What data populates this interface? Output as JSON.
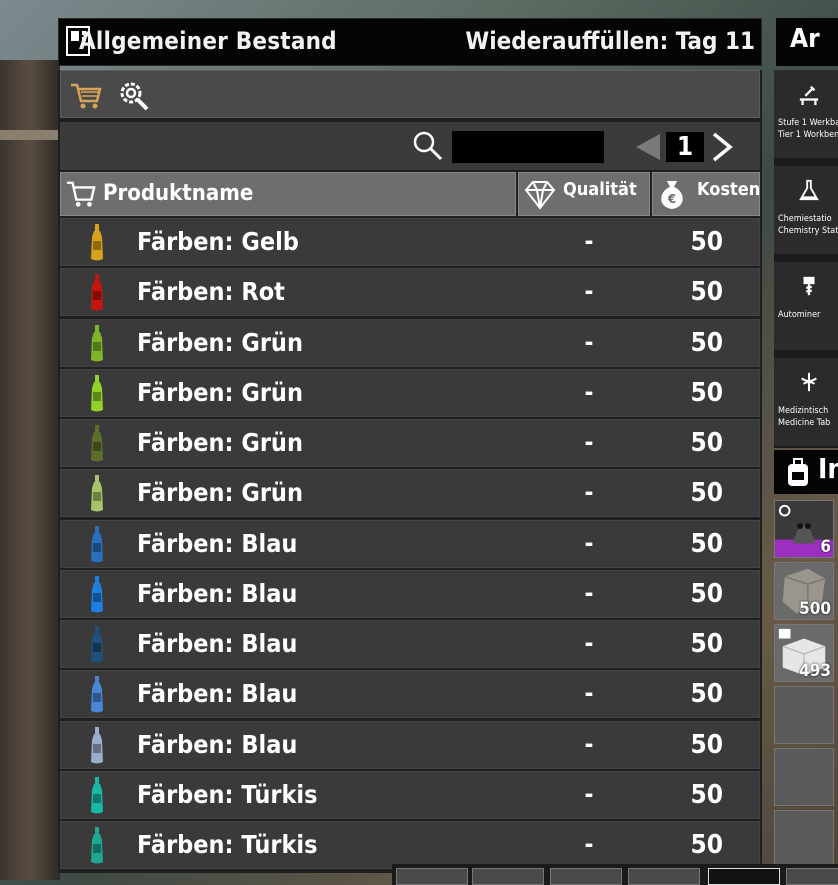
{
  "window": {
    "title": "Allgemeiner Bestand",
    "restock": "Wiederauffüllen: Tag 11"
  },
  "search": {
    "value": "",
    "placeholder": ""
  },
  "pager": {
    "page": "1"
  },
  "columns": {
    "name": "Produktname",
    "quality": "Qualität",
    "cost": "Kosten"
  },
  "items": [
    {
      "name": "Färben: Gelb",
      "quality": "-",
      "cost": "50",
      "color": "#d9a21c"
    },
    {
      "name": "Färben: Rot",
      "quality": "-",
      "cost": "50",
      "color": "#c3160f"
    },
    {
      "name": "Färben: Grün",
      "quality": "-",
      "cost": "50",
      "color": "#7fb52a"
    },
    {
      "name": "Färben: Grün",
      "quality": "-",
      "cost": "50",
      "color": "#8fd22a"
    },
    {
      "name": "Färben: Grün",
      "quality": "-",
      "cost": "50",
      "color": "#5c6e2c"
    },
    {
      "name": "Färben: Grün",
      "quality": "-",
      "cost": "50",
      "color": "#a8c46a"
    },
    {
      "name": "Färben: Blau",
      "quality": "-",
      "cost": "50",
      "color": "#2a6fbd"
    },
    {
      "name": "Färben: Blau",
      "quality": "-",
      "cost": "50",
      "color": "#1d7fe0"
    },
    {
      "name": "Färben: Blau",
      "quality": "-",
      "cost": "50",
      "color": "#1f4f7a"
    },
    {
      "name": "Färben: Blau",
      "quality": "-",
      "cost": "50",
      "color": "#4a86d6"
    },
    {
      "name": "Färben: Blau",
      "quality": "-",
      "cost": "50",
      "color": "#9aaecb"
    },
    {
      "name": "Färben: Türkis",
      "quality": "-",
      "cost": "50",
      "color": "#18b8a6"
    },
    {
      "name": "Färben: Türkis",
      "quality": "-",
      "cost": "50",
      "color": "#1ea892"
    }
  ],
  "side": {
    "title": "Ar",
    "stations": [
      {
        "l1": "Stufe 1 Werkba",
        "l2": "Tier 1 Workben",
        "icon": "workbench-icon"
      },
      {
        "l1": "Chemiestatio",
        "l2": "Chemistry Stati",
        "icon": "flask-icon"
      },
      {
        "l1": "Autominer",
        "l2": "",
        "icon": "drill-icon"
      },
      {
        "l1": "Medizintisch",
        "l2": "Medicine Tab",
        "icon": "medicine-icon"
      }
    ],
    "inventory_title": "In",
    "slots": [
      {
        "count": "6",
        "icon": "mask-icon"
      },
      {
        "count": "500",
        "icon": "stone-icon"
      },
      {
        "count": "493",
        "icon": "concrete-icon"
      },
      {
        "count": "",
        "icon": ""
      },
      {
        "count": "",
        "icon": ""
      },
      {
        "count": "",
        "icon": ""
      }
    ]
  }
}
